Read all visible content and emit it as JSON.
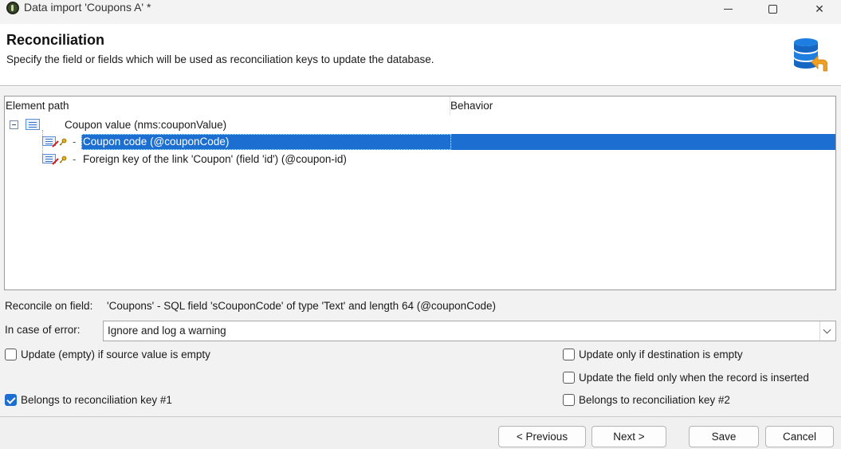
{
  "window": {
    "title": "Data import 'Coupons A' *",
    "controls": {
      "minimize": "minimize",
      "maximize": "maximize",
      "close": "✕"
    }
  },
  "header": {
    "title": "Reconciliation",
    "subtitle": "Specify the field or fields which will be used as reconciliation keys to update the database."
  },
  "tree": {
    "columns": [
      "Element path",
      "Behavior"
    ],
    "rows": [
      {
        "label": "Coupon value (nms:couponValue)",
        "behavior": "",
        "level": 0,
        "expanded": true,
        "selected": false
      },
      {
        "label": "Coupon code (@couponCode)",
        "behavior": "",
        "level": 1,
        "selected": true
      },
      {
        "label": "Foreign key of the link 'Coupon' (field 'id') (@coupon-id)",
        "behavior": "",
        "level": 1,
        "selected": false
      }
    ]
  },
  "reconcile": {
    "label": "Reconcile on field:",
    "value": "'Coupons' - SQL field 'sCouponCode' of type 'Text' and length 64 (@couponCode)"
  },
  "error": {
    "label": "In case of error:",
    "selected": "Ignore and log a warning"
  },
  "options": {
    "update_empty": {
      "label": "Update (empty) if source value is empty",
      "checked": false
    },
    "update_if_dest_empty": {
      "label": "Update only if destination is empty",
      "checked": false
    },
    "update_on_insert": {
      "label": "Update the field only when the record is inserted",
      "checked": false
    },
    "key1": {
      "label": "Belongs to reconciliation key #1",
      "checked": true
    },
    "key2": {
      "label": "Belongs to reconciliation key #2",
      "checked": false
    }
  },
  "footer": {
    "previous": "< Previous",
    "next": "Next >",
    "save": "Save",
    "cancel": "Cancel"
  },
  "colors": {
    "selection": "#1c6fd0",
    "checkbox_checked": "#1c6fd0",
    "db_icon": "#1e7fe0",
    "arrow_icon": "#f0a020"
  }
}
